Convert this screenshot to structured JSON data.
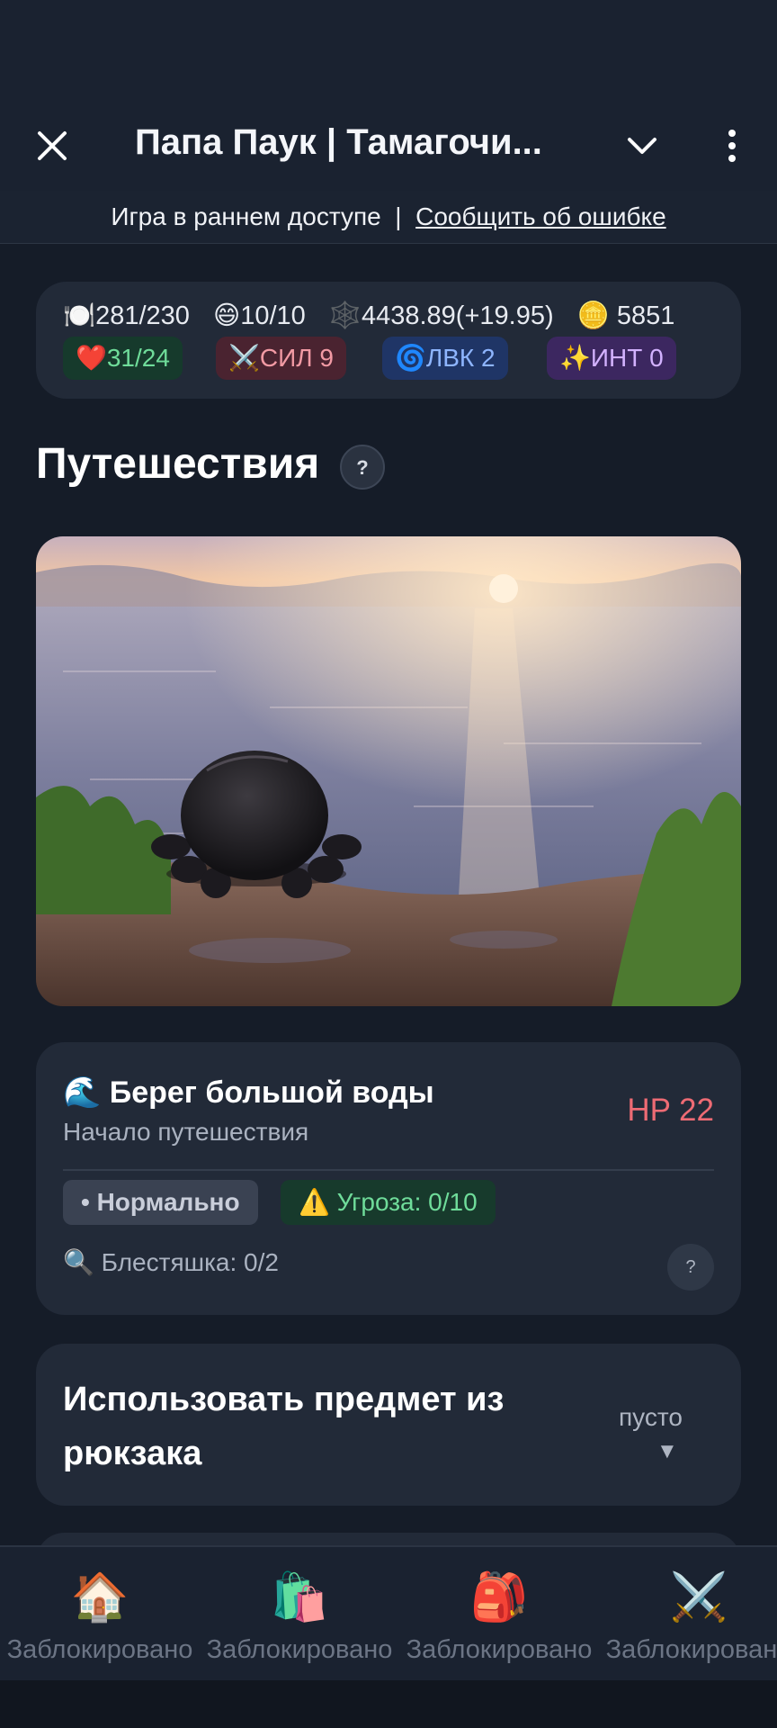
{
  "header": {
    "title": "Папа Паук | Тамагочи...",
    "close_icon": "close-icon",
    "chevron_icon": "chevron-down-icon",
    "menu_icon": "more-vertical-icon"
  },
  "banner": {
    "text": "Игра в раннем доступе",
    "separator": "|",
    "link": "Сообщить об ошибке"
  },
  "stats": {
    "food": "🍽️281/230",
    "mood": "😄10/10",
    "web": "🕸️4438.89(+19.95)",
    "coins": "🪙 5851",
    "hp": "❤️31/24",
    "strength": "⚔️СИЛ 9",
    "agility": "🌀ЛВК 2",
    "intellect": "✨ИНТ 0"
  },
  "section": {
    "title": "Путешествия",
    "help": "?"
  },
  "location": {
    "title": "🌊 Берег большой воды",
    "subtitle": "Начало путешествия",
    "hp": "HP 22",
    "status": "• Нормально",
    "threat": "⚠️ Угроза: 0/10",
    "search": "🔍 Блестяшка: 0/2",
    "help": "?"
  },
  "backpack": {
    "title": "Использовать предмет из рюкзака",
    "value": "пусто",
    "arrow": "▼"
  },
  "nav": {
    "items": [
      {
        "icon": "🏠",
        "label": "Заблокировано"
      },
      {
        "icon": "🛍️",
        "label": "Заблокировано"
      },
      {
        "icon": "🎒",
        "label": "Заблокировано"
      },
      {
        "icon": "⚔️",
        "label": "Заблокировано"
      }
    ]
  },
  "colors": {
    "background": "#151c28",
    "card": "#222a38",
    "hp_red": "#ee6b74",
    "threat_green": "#6fdc9a"
  }
}
